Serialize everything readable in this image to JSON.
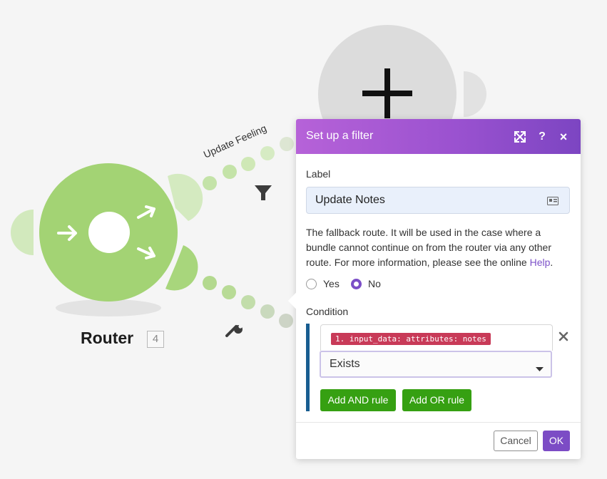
{
  "router": {
    "name": "Router",
    "badge": "4"
  },
  "route_top": {
    "label": "Update Feeling"
  },
  "dialog": {
    "title": "Set up a filter",
    "label_field_label": "Label",
    "label_value": "Update Notes",
    "fallback_text": "The fallback route. It will be used in the case where a bundle cannot continue on from the router via any other route. For more information, please see the online ",
    "help_link": "Help",
    "help_suffix": ".",
    "yes_label": "Yes",
    "no_label": "No",
    "selected_option": "No",
    "condition_label": "Condition",
    "condition_operand": "1. input_data: attributes: notes",
    "condition_operator": "Exists",
    "add_and_label": "Add AND rule",
    "add_or_label": "Add OR rule",
    "cancel_label": "Cancel",
    "ok_label": "OK"
  },
  "colors": {
    "router_green": "#a3d374",
    "header_purple": "#9b52d0",
    "action_green": "#36a012",
    "ok_purple": "#7c4cc5",
    "pill_red": "#c83a58"
  }
}
